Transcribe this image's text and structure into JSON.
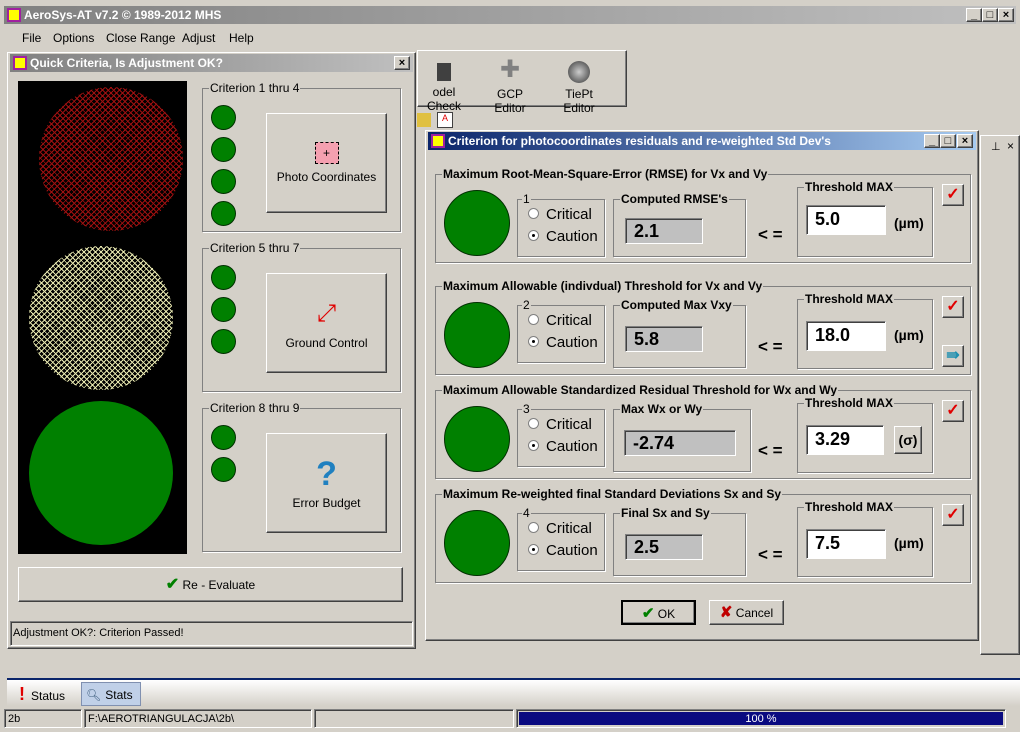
{
  "app": {
    "title": "AeroSys-AT  v7.2 © 1989-2012 MHS",
    "menu": [
      "File",
      "Options",
      "Close Range",
      "Adjust",
      "Help"
    ]
  },
  "toolbar": {
    "items": [
      "odel Check",
      "GCP Editor",
      "TiePt Editor"
    ]
  },
  "quick": {
    "title": "Quick Criteria,  Is Adjustment OK?",
    "groups": [
      {
        "label": "Criterion 1 thru 4",
        "button": "Photo Coordinates"
      },
      {
        "label": "Criterion 5 thru 7",
        "button": "Ground Control"
      },
      {
        "label": "Criterion 8 thru 9",
        "button": "Error Budget"
      }
    ],
    "reevaluate": "Re - Evaluate",
    "status": "Adjustment OK?: Criterion Passed!"
  },
  "dialog": {
    "title": "Criterion for photocoordinates residuals and re-weighted Std Dev's",
    "critical": "Critical",
    "caution": "Caution",
    "le": "< =",
    "threshold_label": "Threshold  MAX",
    "criteria": [
      {
        "title": "Maximum Root-Mean-Square-Error (RMSE) for  Vx  and  Vy",
        "num": "1",
        "computed_label": "Computed RMSE's",
        "computed": "2.1",
        "threshold": "5.0",
        "unit": "(µm)"
      },
      {
        "title": "Maximum Allowable (indivdual) Threshold for  Vx  and  Vy",
        "num": "2",
        "computed_label": "Computed Max Vxy",
        "computed": "5.8",
        "threshold": "18.0",
        "unit": "(µm)"
      },
      {
        "title": "Maximum Allowable Standardized Residual Threshold for Wx and Wy",
        "num": "3",
        "computed_label": "Max Wx or Wy",
        "computed": "-2.74",
        "threshold": "3.29",
        "unit": "(σ)"
      },
      {
        "title": "Maximum Re-weighted final Standard Deviations Sx and Sy",
        "num": "4",
        "computed_label": "Final Sx and Sy",
        "computed": "2.5",
        "threshold": "7.5",
        "unit": "(µm)"
      }
    ],
    "ok": "OK",
    "cancel": "Cancel"
  },
  "tabs": [
    "Status",
    "Stats"
  ],
  "statusbar": {
    "project": "2b",
    "path": "F:\\AEROTRIANGULACJA\\2b\\",
    "progress_text": "100 %",
    "progress": 1.0
  },
  "colors": {
    "green": "#008000",
    "title_active": "#0a246a",
    "progress": "#0a0a80"
  }
}
